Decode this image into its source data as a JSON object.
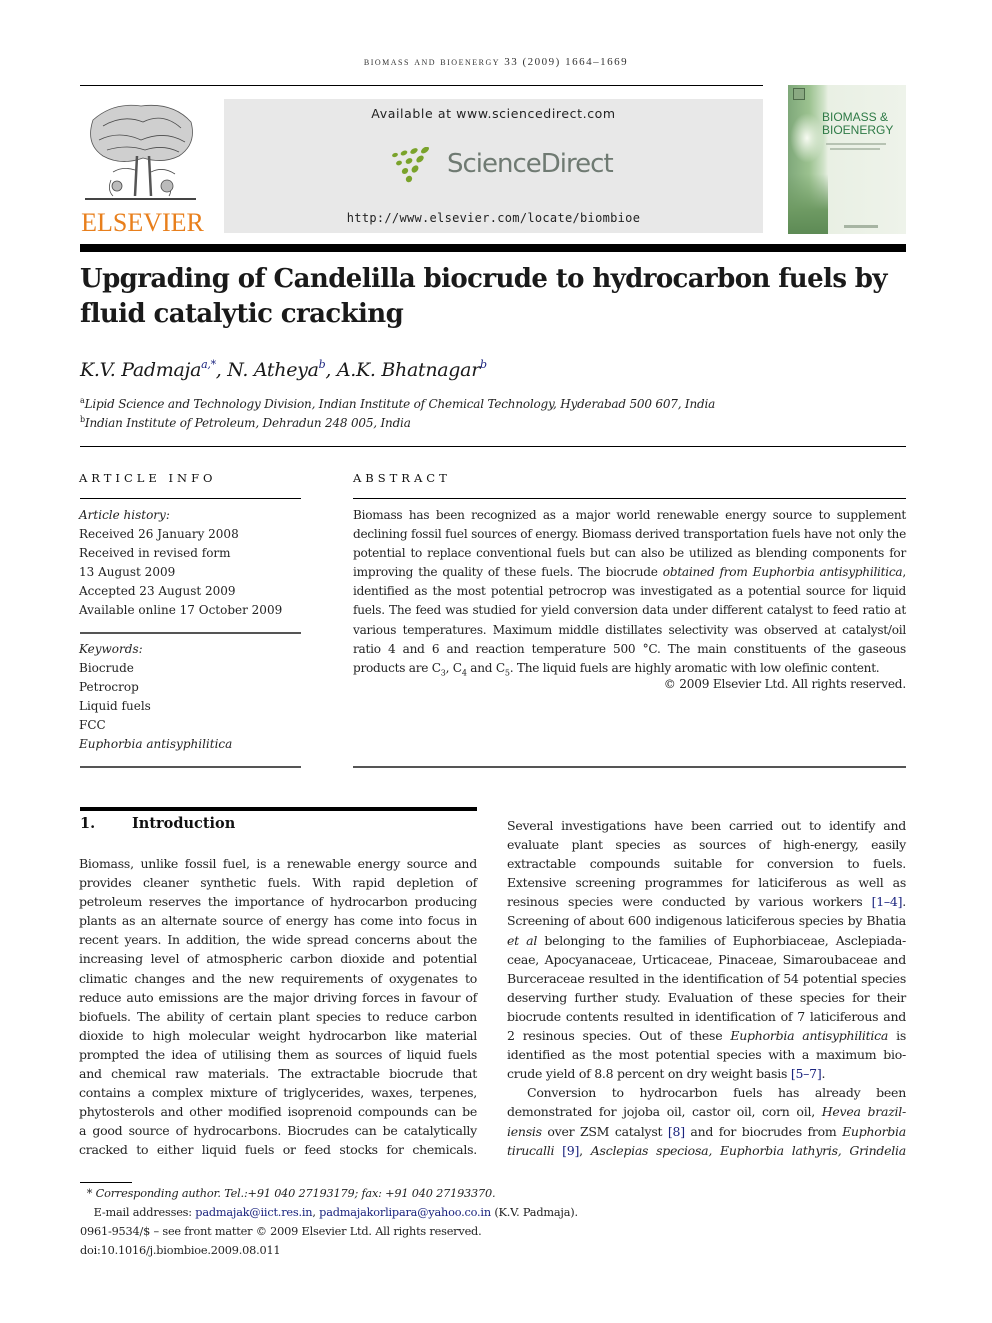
{
  "running_head": "Biomass and Bioenergy 33 (2009) 1664–1669",
  "publisher": {
    "logo_text": "ELSEVIER",
    "logo_icon": "elsevier-tree-icon",
    "brand_color": "#e87f1c"
  },
  "sciencedirect": {
    "available": "Available at www.sciencedirect.com",
    "logo_text": "ScienceDirect",
    "logo_icon": "sciencedirect-dots-icon",
    "logo_color": "#7aa32b",
    "url": "http://www.elsevier.com/locate/biombioe"
  },
  "journal_cover": {
    "title_line1": "BIOMASS &",
    "title_line2": "BIOENERGY",
    "title_color": "#2e7a46"
  },
  "article": {
    "title": "Upgrading of Candelilla biocrude to hydrocarbon fuels by fluid catalytic cracking",
    "authors": [
      {
        "name": "K.V. Padmaja",
        "sup": "a,*"
      },
      {
        "name": "N. Atheya",
        "sup": "b"
      },
      {
        "name": "A.K. Bhatnagar",
        "sup": "b"
      }
    ],
    "affiliations": [
      {
        "mark": "a",
        "text": "Lipid Science and Technology Division, Indian Institute of Chemical Technology, Hyderabad 500 607, India"
      },
      {
        "mark": "b",
        "text": "Indian Institute of Petroleum, Dehradun 248 005, India"
      }
    ]
  },
  "article_info": {
    "label": "ARTICLE INFO",
    "history_label": "Article history:",
    "history": [
      "Received 26 January 2008",
      "Received in revised form",
      "13 August 2009",
      "Accepted 23 August 2009",
      "Available online 17 October 2009"
    ],
    "keywords_label": "Keywords:",
    "keywords": [
      "Biocrude",
      "Petrocrop",
      "Liquid fuels",
      "FCC",
      "Euphorbia antisyphilitica"
    ]
  },
  "abstract": {
    "label": "ABSTRACT",
    "text_part1": "Biomass has been recognized as a major world renewable energy source to supplement declining fossil fuel sources of energy. Biomass derived transportation fuels have not only the potential to replace conventional fuels but can also be utilized as blending components for improving the quality of these fuels. The biocrude ",
    "text_italic": "obtained from Euphorbia antisyphilitica",
    "text_part2": ", identified as the most potential petrocrop was investigated as a potential source for liquid fuels. The feed was studied for yield conversion data under different catalyst to feed ratio at various temperatures. Maximum middle distillates selectivity was observed at catalyst/oil ratio 4 and 6 and reaction temperature 500 °C. The main constituents of the gaseous products are C",
    "sub3": "3",
    "sep1": ", C",
    "sub4": "4",
    "sep2": " and C",
    "sub5": "5",
    "text_part3": ". The liquid fuels are highly aromatic with low olefinic content.",
    "copyright": "© 2009 Elsevier Ltd. All rights reserved."
  },
  "section1": {
    "number": "1.",
    "title": "Introduction",
    "left_lines": [
      "Biomass, unlike fossil fuel, is a renewable energy source and",
      "provides cleaner synthetic fuels. With rapid depletion of",
      "petroleum reserves the importance of hydrocarbon producing",
      "plants as an alternate source of energy has come into focus in",
      "recent years. In addition, the wide spread concerns about the",
      "increasing level of atmospheric carbon dioxide and potential",
      "climatic changes and the new requirements of oxygenates to",
      "reduce auto emissions are the major driving forces in favour of",
      "biofuels. The ability of certain plant species to reduce carbon",
      "dioxide to high molecular weight hydrocarbon like material",
      "prompted the idea of utilising them as sources of liquid fuels",
      "and chemical raw materials. The extractable biocrude that",
      "contains a complex mixture of triglycerides, waxes, terpenes,",
      "phytosterols and other modified isoprenoid compounds can be",
      "a good source of hydrocarbons. Biocrudes can be catalytically",
      "cracked to either liquid fuels or feed stocks for chemicals."
    ],
    "right": {
      "l1": "Several investigations have been carried out to identify and",
      "l2": "evaluate plant species as sources of high-energy, easily",
      "l3": "extractable compounds suitable for conversion to fuels.",
      "l4": "Extensive screening programmes for laticiferous as well as",
      "l5_text": "resinous species were conducted by various workers ",
      "l5_ref": "[1–4]",
      "l5_end": ".",
      "l6": "Screening of about 600 indigenous laticiferous species by Bhatia",
      "l7_it": "et al",
      "l7_text": " belonging to the families of Euphorbiaceae, Asclepiada-",
      "l8": "ceae, Apocyanaceae, Urticaceae, Pinaceae, Simaroubaceae and",
      "l9": "Burceraceae resulted in the identification of 54 potential species",
      "l10": "deserving further study. Evaluation of these species for their",
      "l11": "biocrude contents resulted in identification of 7 laticiferous and",
      "l12_text": "2 resinous species. Out of these ",
      "l12_it": "Euphorbia antisyphilitica",
      "l12_end": " is",
      "l13": "identified as the most potential species with a maximum bio-",
      "l14_text": "crude yield of 8.8 percent on dry weight basis ",
      "l14_ref": "[5–7]",
      "l14_end": ".",
      "l15": "Conversion to hydrocarbon fuels has already been",
      "l16_text": "demonstrated for jojoba oil, castor oil, corn oil, ",
      "l16_it": "Hevea brazil-",
      "l17_it": "iensis",
      "l17_text": " over ZSM catalyst ",
      "l17_ref": "[8]",
      "l17_text2": " and for biocrudes from ",
      "l17_it2": "Euphorbia",
      "l18_it": "tirucalli",
      "l18_ref": "[9]",
      "l18_it2": "Asclepias speciosa, Euphorbia lathyris, Grindelia"
    }
  },
  "footnotes": {
    "corresponding_mark": "*",
    "corresponding": "Corresponding author. Tel.:+91 040 27193179; fax: +91 040 27193370.",
    "email_label": "E-mail addresses: ",
    "email1": "padmajak@iict.res.in",
    "email2": "padmajakorlipara@yahoo.co.in",
    "email_suffix": " (K.V. Padmaja).",
    "issn": "0961-9534/$ – see front matter © 2009 Elsevier Ltd. All rights reserved.",
    "doi": "doi:10.1016/j.biombioe.2009.08.011"
  }
}
